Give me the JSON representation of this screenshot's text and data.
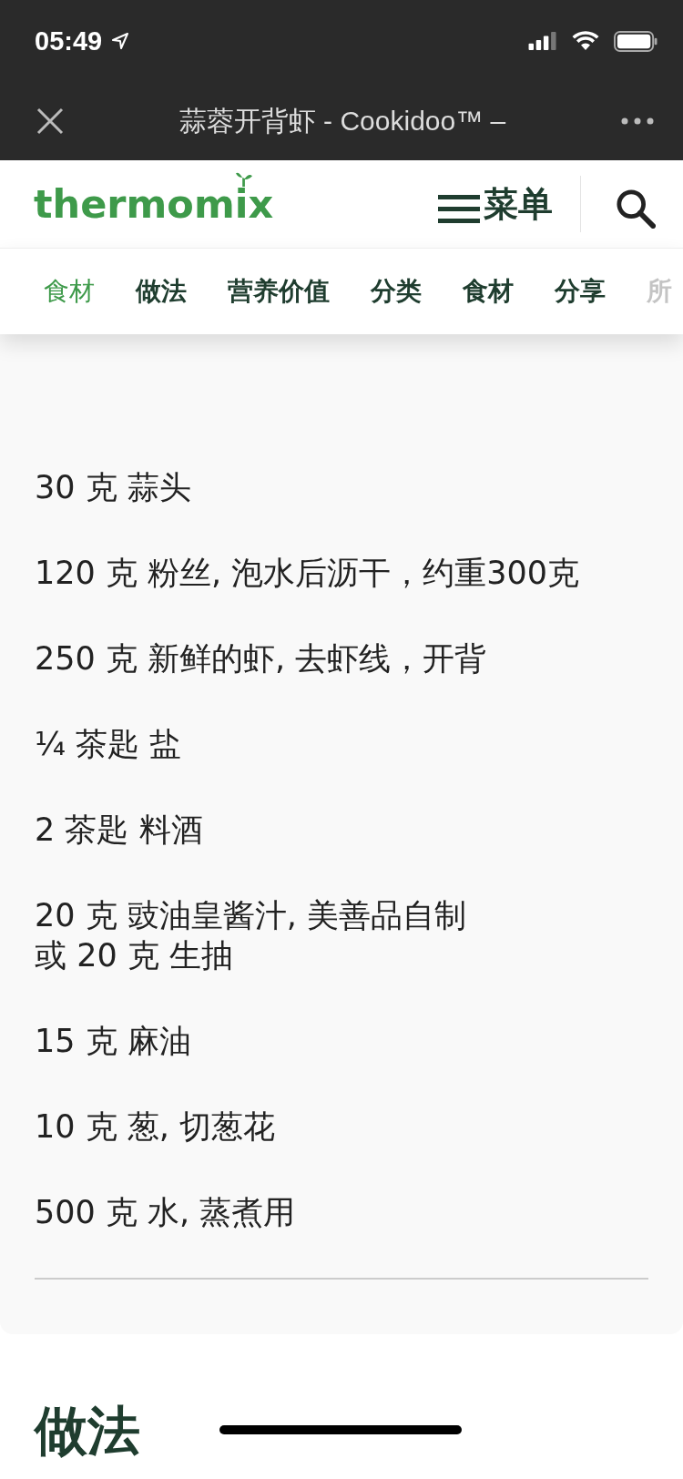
{
  "status_bar": {
    "time": "05:49"
  },
  "browser_bar": {
    "title": "蒜蓉开背虾 - Cookidoo™ –"
  },
  "header": {
    "logo": "thermomix",
    "menu_label": "菜单"
  },
  "tabs": [
    {
      "label": "食材",
      "selected": true
    },
    {
      "label": "做法",
      "selected": false
    },
    {
      "label": "营养价值",
      "selected": false
    },
    {
      "label": "分类",
      "selected": false
    },
    {
      "label": "食材",
      "selected": false
    },
    {
      "label": "分享",
      "selected": false
    },
    {
      "label": "所",
      "selected": false
    }
  ],
  "ingredients_section": {
    "items": [
      {
        "text": "30 克 蒜头"
      },
      {
        "text": "120 克 粉丝, 泡水后沥干，约重300克"
      },
      {
        "text": "250 克 新鲜的虾, 去虾线，开背"
      },
      {
        "text": "¼ 茶匙 盐"
      },
      {
        "text": "2 茶匙 料酒"
      },
      {
        "text": "20 克 豉油皇酱汁, 美善品自制",
        "alternative": "或 20 克 生抽"
      },
      {
        "text": "15 克 麻油"
      },
      {
        "text": "10 克 葱, 切葱花"
      },
      {
        "text": "500 克 水, 蒸煮用"
      }
    ]
  },
  "method_section": {
    "heading": "做法"
  }
}
